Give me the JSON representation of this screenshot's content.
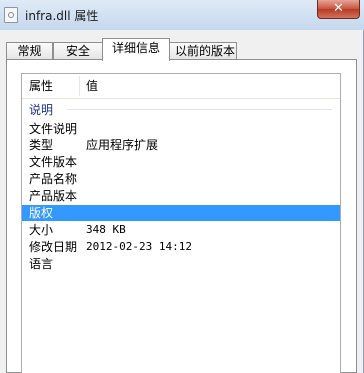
{
  "window": {
    "title": "infra.dll 属性",
    "close_label": "✕"
  },
  "tabs": [
    {
      "label": "常规",
      "active": false
    },
    {
      "label": "安全",
      "active": false
    },
    {
      "label": "详细信息",
      "active": true
    },
    {
      "label": "以前的版本",
      "active": false
    }
  ],
  "details": {
    "columns": {
      "property": "属性",
      "value": "值"
    },
    "group_label": "说明",
    "rows": [
      {
        "key": "文件说明",
        "value": ""
      },
      {
        "key": "类型",
        "value": "应用程序扩展"
      },
      {
        "key": "文件版本",
        "value": ""
      },
      {
        "key": "产品名称",
        "value": ""
      },
      {
        "key": "产品版本",
        "value": ""
      },
      {
        "key": "版权",
        "value": "",
        "selected": true
      },
      {
        "key": "大小",
        "value": "348 KB"
      },
      {
        "key": "修改日期",
        "value": "2012-02-23 14:12"
      },
      {
        "key": "语言",
        "value": ""
      }
    ]
  },
  "colors": {
    "selection": "#3399ff",
    "group_text": "#1e3287"
  }
}
